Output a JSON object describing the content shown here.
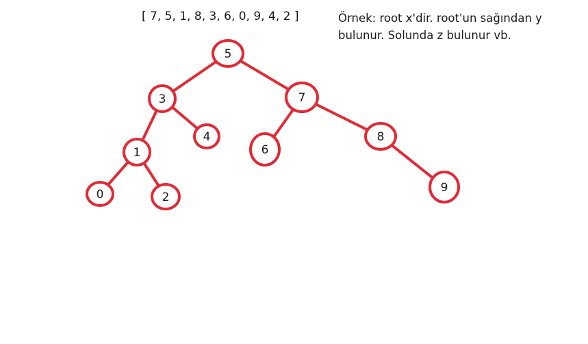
{
  "header": {
    "array_text": "[ 7, 5, 1, 8, 3, 6, 0, 9, 4, 2 ]"
  },
  "note": {
    "line1": "Örnek: root x'dir. root'un sağından y",
    "line2": "bulunur. Solunda z bulunur vb."
  },
  "tree": {
    "stroke_color": "#e02a35",
    "nodes": [
      {
        "id": "n5",
        "label": "5"
      },
      {
        "id": "n3",
        "label": "3"
      },
      {
        "id": "n7",
        "label": "7"
      },
      {
        "id": "n4",
        "label": "4"
      },
      {
        "id": "n6",
        "label": "6"
      },
      {
        "id": "n8",
        "label": "8"
      },
      {
        "id": "n1",
        "label": "1"
      },
      {
        "id": "n0",
        "label": "0"
      },
      {
        "id": "n2",
        "label": "2"
      },
      {
        "id": "n9",
        "label": "9"
      }
    ],
    "edges": [
      {
        "from": "n5",
        "to": "n3"
      },
      {
        "from": "n5",
        "to": "n7"
      },
      {
        "from": "n3",
        "to": "n1"
      },
      {
        "from": "n3",
        "to": "n4"
      },
      {
        "from": "n1",
        "to": "n0"
      },
      {
        "from": "n1",
        "to": "n2"
      },
      {
        "from": "n7",
        "to": "n6"
      },
      {
        "from": "n7",
        "to": "n8"
      },
      {
        "from": "n8",
        "to": "n9"
      }
    ]
  }
}
